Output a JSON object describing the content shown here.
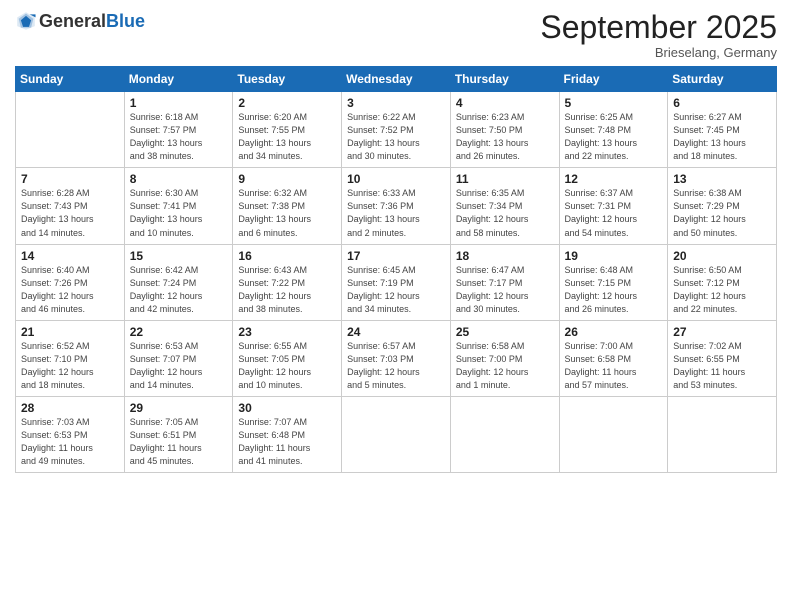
{
  "header": {
    "logo_general": "General",
    "logo_blue": "Blue",
    "month_title": "September 2025",
    "subtitle": "Brieselang, Germany"
  },
  "days_of_week": [
    "Sunday",
    "Monday",
    "Tuesday",
    "Wednesday",
    "Thursday",
    "Friday",
    "Saturday"
  ],
  "weeks": [
    [
      {
        "day": "",
        "info": ""
      },
      {
        "day": "1",
        "info": "Sunrise: 6:18 AM\nSunset: 7:57 PM\nDaylight: 13 hours\nand 38 minutes."
      },
      {
        "day": "2",
        "info": "Sunrise: 6:20 AM\nSunset: 7:55 PM\nDaylight: 13 hours\nand 34 minutes."
      },
      {
        "day": "3",
        "info": "Sunrise: 6:22 AM\nSunset: 7:52 PM\nDaylight: 13 hours\nand 30 minutes."
      },
      {
        "day": "4",
        "info": "Sunrise: 6:23 AM\nSunset: 7:50 PM\nDaylight: 13 hours\nand 26 minutes."
      },
      {
        "day": "5",
        "info": "Sunrise: 6:25 AM\nSunset: 7:48 PM\nDaylight: 13 hours\nand 22 minutes."
      },
      {
        "day": "6",
        "info": "Sunrise: 6:27 AM\nSunset: 7:45 PM\nDaylight: 13 hours\nand 18 minutes."
      }
    ],
    [
      {
        "day": "7",
        "info": "Sunrise: 6:28 AM\nSunset: 7:43 PM\nDaylight: 13 hours\nand 14 minutes."
      },
      {
        "day": "8",
        "info": "Sunrise: 6:30 AM\nSunset: 7:41 PM\nDaylight: 13 hours\nand 10 minutes."
      },
      {
        "day": "9",
        "info": "Sunrise: 6:32 AM\nSunset: 7:38 PM\nDaylight: 13 hours\nand 6 minutes."
      },
      {
        "day": "10",
        "info": "Sunrise: 6:33 AM\nSunset: 7:36 PM\nDaylight: 13 hours\nand 2 minutes."
      },
      {
        "day": "11",
        "info": "Sunrise: 6:35 AM\nSunset: 7:34 PM\nDaylight: 12 hours\nand 58 minutes."
      },
      {
        "day": "12",
        "info": "Sunrise: 6:37 AM\nSunset: 7:31 PM\nDaylight: 12 hours\nand 54 minutes."
      },
      {
        "day": "13",
        "info": "Sunrise: 6:38 AM\nSunset: 7:29 PM\nDaylight: 12 hours\nand 50 minutes."
      }
    ],
    [
      {
        "day": "14",
        "info": "Sunrise: 6:40 AM\nSunset: 7:26 PM\nDaylight: 12 hours\nand 46 minutes."
      },
      {
        "day": "15",
        "info": "Sunrise: 6:42 AM\nSunset: 7:24 PM\nDaylight: 12 hours\nand 42 minutes."
      },
      {
        "day": "16",
        "info": "Sunrise: 6:43 AM\nSunset: 7:22 PM\nDaylight: 12 hours\nand 38 minutes."
      },
      {
        "day": "17",
        "info": "Sunrise: 6:45 AM\nSunset: 7:19 PM\nDaylight: 12 hours\nand 34 minutes."
      },
      {
        "day": "18",
        "info": "Sunrise: 6:47 AM\nSunset: 7:17 PM\nDaylight: 12 hours\nand 30 minutes."
      },
      {
        "day": "19",
        "info": "Sunrise: 6:48 AM\nSunset: 7:15 PM\nDaylight: 12 hours\nand 26 minutes."
      },
      {
        "day": "20",
        "info": "Sunrise: 6:50 AM\nSunset: 7:12 PM\nDaylight: 12 hours\nand 22 minutes."
      }
    ],
    [
      {
        "day": "21",
        "info": "Sunrise: 6:52 AM\nSunset: 7:10 PM\nDaylight: 12 hours\nand 18 minutes."
      },
      {
        "day": "22",
        "info": "Sunrise: 6:53 AM\nSunset: 7:07 PM\nDaylight: 12 hours\nand 14 minutes."
      },
      {
        "day": "23",
        "info": "Sunrise: 6:55 AM\nSunset: 7:05 PM\nDaylight: 12 hours\nand 10 minutes."
      },
      {
        "day": "24",
        "info": "Sunrise: 6:57 AM\nSunset: 7:03 PM\nDaylight: 12 hours\nand 5 minutes."
      },
      {
        "day": "25",
        "info": "Sunrise: 6:58 AM\nSunset: 7:00 PM\nDaylight: 12 hours\nand 1 minute."
      },
      {
        "day": "26",
        "info": "Sunrise: 7:00 AM\nSunset: 6:58 PM\nDaylight: 11 hours\nand 57 minutes."
      },
      {
        "day": "27",
        "info": "Sunrise: 7:02 AM\nSunset: 6:55 PM\nDaylight: 11 hours\nand 53 minutes."
      }
    ],
    [
      {
        "day": "28",
        "info": "Sunrise: 7:03 AM\nSunset: 6:53 PM\nDaylight: 11 hours\nand 49 minutes."
      },
      {
        "day": "29",
        "info": "Sunrise: 7:05 AM\nSunset: 6:51 PM\nDaylight: 11 hours\nand 45 minutes."
      },
      {
        "day": "30",
        "info": "Sunrise: 7:07 AM\nSunset: 6:48 PM\nDaylight: 11 hours\nand 41 minutes."
      },
      {
        "day": "",
        "info": ""
      },
      {
        "day": "",
        "info": ""
      },
      {
        "day": "",
        "info": ""
      },
      {
        "day": "",
        "info": ""
      }
    ]
  ]
}
